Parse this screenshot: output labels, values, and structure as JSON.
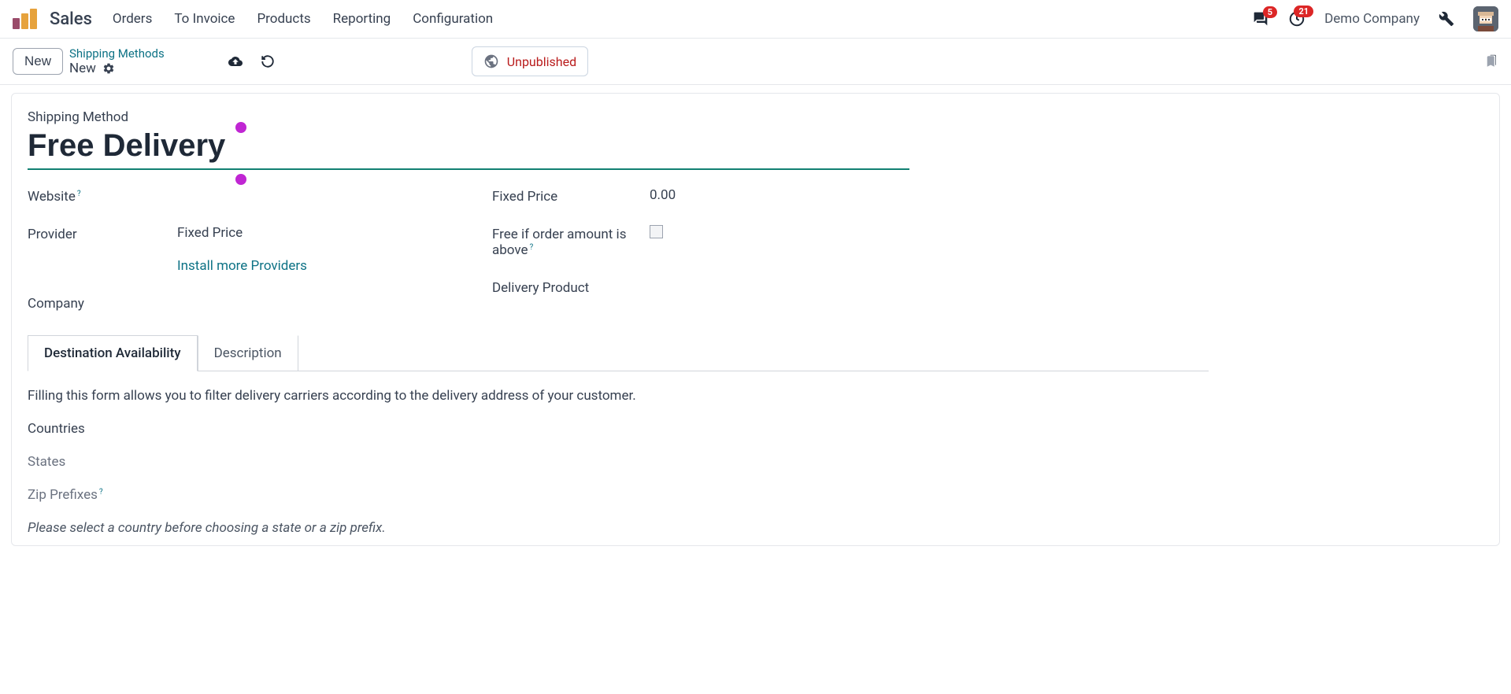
{
  "topbar": {
    "app_name": "Sales",
    "nav": [
      "Orders",
      "To Invoice",
      "Products",
      "Reporting",
      "Configuration"
    ],
    "chat_badge": "5",
    "activity_badge": "21",
    "company": "Demo Company"
  },
  "secondbar": {
    "new_btn": "New",
    "breadcrumb_parent": "Shipping Methods",
    "breadcrumb_current": "New",
    "status_label": "Unpublished"
  },
  "form": {
    "title_label": "Shipping Method",
    "title_value": "Free Delivery",
    "left": {
      "website_label": "Website",
      "provider_label": "Provider",
      "provider_value": "Fixed Price",
      "install_link": "Install more Providers",
      "company_label": "Company"
    },
    "right": {
      "fixed_price_label": "Fixed Price",
      "fixed_price_value": "0.00",
      "free_if_label": "Free if order amount is above",
      "delivery_product_label": "Delivery Product"
    },
    "tabs": {
      "dest": "Destination Availability",
      "desc": "Description"
    },
    "tab_content": {
      "intro": "Filling this form allows you to filter delivery carriers according to the delivery address of your customer.",
      "countries": "Countries",
      "states": "States",
      "zip": "Zip Prefixes",
      "warning": "Please select a country before choosing a state or a zip prefix."
    }
  }
}
